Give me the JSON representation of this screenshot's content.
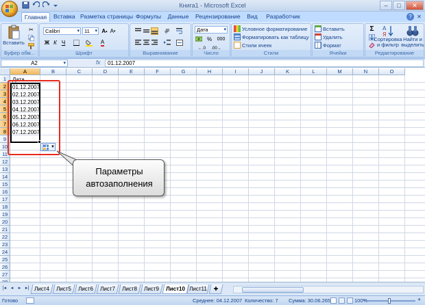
{
  "window": {
    "title": "Книга1 - Microsoft Excel",
    "controls": [
      "–",
      "□",
      "✕"
    ]
  },
  "ribbon_tabs": [
    {
      "label": "Главная",
      "active": true
    },
    {
      "label": "Вставка"
    },
    {
      "label": "Разметка страницы"
    },
    {
      "label": "Формулы"
    },
    {
      "label": "Данные"
    },
    {
      "label": "Рецензирование"
    },
    {
      "label": "Вид"
    },
    {
      "label": "Разработчик"
    }
  ],
  "ribbon": {
    "clipboard": {
      "label": "Буфер обм...",
      "paste": "Вставить"
    },
    "font": {
      "label": "Шрифт",
      "name": "Calibri",
      "size": "11",
      "bold": "Ж",
      "italic": "К",
      "underline": "Ч"
    },
    "alignment": {
      "label": "Выравнивание"
    },
    "number": {
      "label": "Число",
      "format": "Дата",
      "percent": "%",
      "thousands": "000"
    },
    "styles": {
      "label": "Стили",
      "conditional": "Условное форматирование",
      "as_table": "Форматировать как таблицу",
      "cell_styles": "Стили ячеек"
    },
    "cells": {
      "label": "Ячейки",
      "insert": "Вставить",
      "delete": "Удалить",
      "format": "Формат"
    },
    "editing": {
      "label": "Редактирование",
      "sort_1": "Сортировка",
      "sort_2": "и фильтр",
      "find_1": "Найти и",
      "find_2": "выделить",
      "sigma": "Σ"
    }
  },
  "formula_bar": {
    "name_box": "A2",
    "fx": "fx",
    "value": "01.12.2007"
  },
  "columns": [
    "A",
    "B",
    "C",
    "D",
    "E",
    "F",
    "G",
    "H",
    "I",
    "J",
    "K",
    "L",
    "M",
    "N",
    "O"
  ],
  "rows": [
    "1",
    "2",
    "3",
    "4",
    "5",
    "6",
    "7",
    "8",
    "9",
    "10",
    "11",
    "12",
    "13",
    "14",
    "15",
    "16",
    "17",
    "18",
    "19",
    "20",
    "21",
    "22",
    "23",
    "24",
    "25",
    "26",
    "27",
    "28"
  ],
  "cells": {
    "A1": "Дата",
    "A2": "01.12.2007",
    "A3": "02.12.2007",
    "A4": "03.12.2007",
    "A5": "04.12.2007",
    "A6": "05.12.2007",
    "A7": "06.12.2007",
    "A8": "07.12.2007"
  },
  "callout": {
    "line1": "Параметры",
    "line2": "автозаполнения"
  },
  "sheet_tabs": [
    "Лист4",
    "Лист5",
    "Лист6",
    "Лист7",
    "Лист8",
    "Лист9",
    "Лист10",
    "Лист11"
  ],
  "active_sheet": "Лист10",
  "sheet_nav": [
    "|◂",
    "◂",
    "▸",
    "▸|"
  ],
  "status": {
    "ready": "Готово",
    "average": "Среднее: 04.12.2007",
    "count": "Количество: 7",
    "sum": "Сумма: 30.06.2655",
    "zoom": "100%",
    "zoom_minus": "–",
    "zoom_plus": "+"
  },
  "colors": {
    "accent": "#15428b",
    "selection_header": "#f1b65c",
    "red_frame": "#e8291c"
  }
}
